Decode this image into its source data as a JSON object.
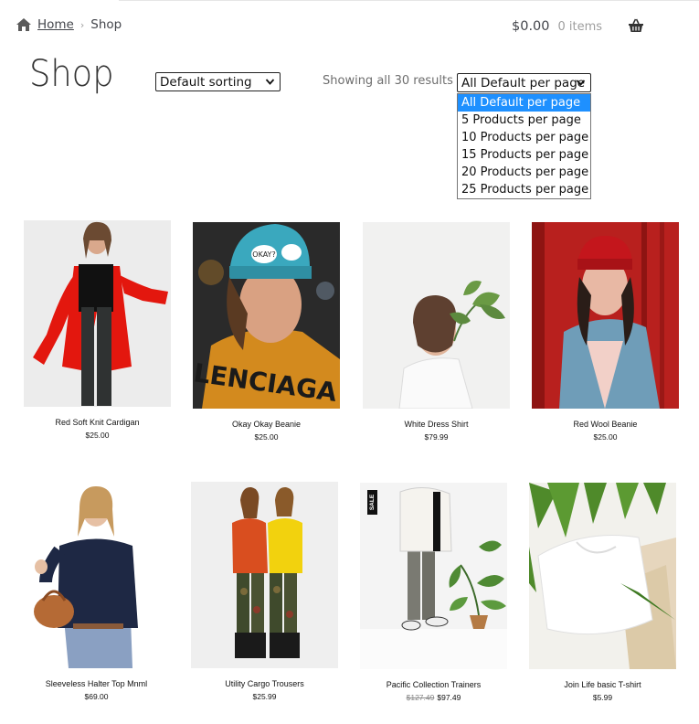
{
  "breadcrumb": {
    "home": "Home",
    "separator": "›",
    "current": "Shop"
  },
  "cart": {
    "amount": "$0.00",
    "count": "0 items"
  },
  "page_title": "Shop",
  "sorting": {
    "selected": "Default sorting"
  },
  "result_count": "Showing all 30 results",
  "per_page": {
    "selected": "All Default per page",
    "options": [
      "All Default per page",
      "5 Products per page",
      "10 Products per page",
      "15 Products per page",
      "20 Products per page",
      "25 Products per page"
    ]
  },
  "products": [
    {
      "name": "Red Soft Knit Cardigan",
      "price": "$25.00"
    },
    {
      "name": "Okay Okay Beanie",
      "price": "$25.00"
    },
    {
      "name": "White Dress Shirt",
      "price": "$79.99"
    },
    {
      "name": "Red Wool Beanie",
      "price": "$25.00"
    },
    {
      "name": "Sleeveless Halter Top Mnml",
      "price": "$69.00"
    },
    {
      "name": "Utility Cargo Trousers",
      "price": "$25.99"
    },
    {
      "name": "Pacific Collection Trainers",
      "old_price": "$127.49",
      "price": "$97.49",
      "badge": "SALE"
    },
    {
      "name": "Join Life basic T-shirt",
      "price": "$5.99"
    }
  ],
  "beanie_text": "OKAY?",
  "shirt_text": "LENCIAGA",
  "colors": {
    "accent_blue": "#1e90ff",
    "text": "#43454b",
    "muted": "#9e9e9e"
  }
}
